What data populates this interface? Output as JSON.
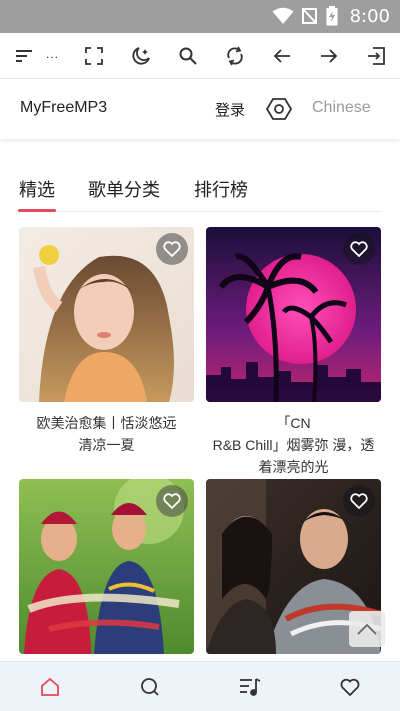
{
  "status_bar": {
    "time": "8:00",
    "icons": [
      "wifi-icon",
      "signal-off-icon",
      "battery-charging-icon"
    ]
  },
  "browser_toolbar": {
    "ellipsis": "...",
    "buttons": [
      "menu-icon",
      "fullscreen-icon",
      "night-mode-icon",
      "search-icon",
      "refresh-icon",
      "back-arrow-icon",
      "forward-arrow-icon",
      "exit-icon"
    ]
  },
  "header": {
    "title": "MyFreeMP3",
    "login": "登录",
    "settings_icon": "hexagon-settings-icon",
    "language": "Chinese"
  },
  "tabs": [
    {
      "label": "精选",
      "active": true
    },
    {
      "label": "歌单分类",
      "active": false
    },
    {
      "label": "排行榜",
      "active": false
    }
  ],
  "playlists": [
    {
      "caption": "欧美治愈集丨恬淡悠远 清凉一夏"
    },
    {
      "caption": "「CN R&B Chill」烟雾弥 漫，透着漂亮的光"
    },
    {
      "caption": ""
    },
    {
      "caption": ""
    }
  ],
  "bottom_nav": [
    "home-icon",
    "search-icon",
    "playlist-icon",
    "favorite-icon"
  ],
  "colors": {
    "accent": "#e2495b",
    "status_bar": "#9e9e9e",
    "language_text": "#9a9a9a",
    "bottom_nav_bg": "#eef3f9"
  }
}
